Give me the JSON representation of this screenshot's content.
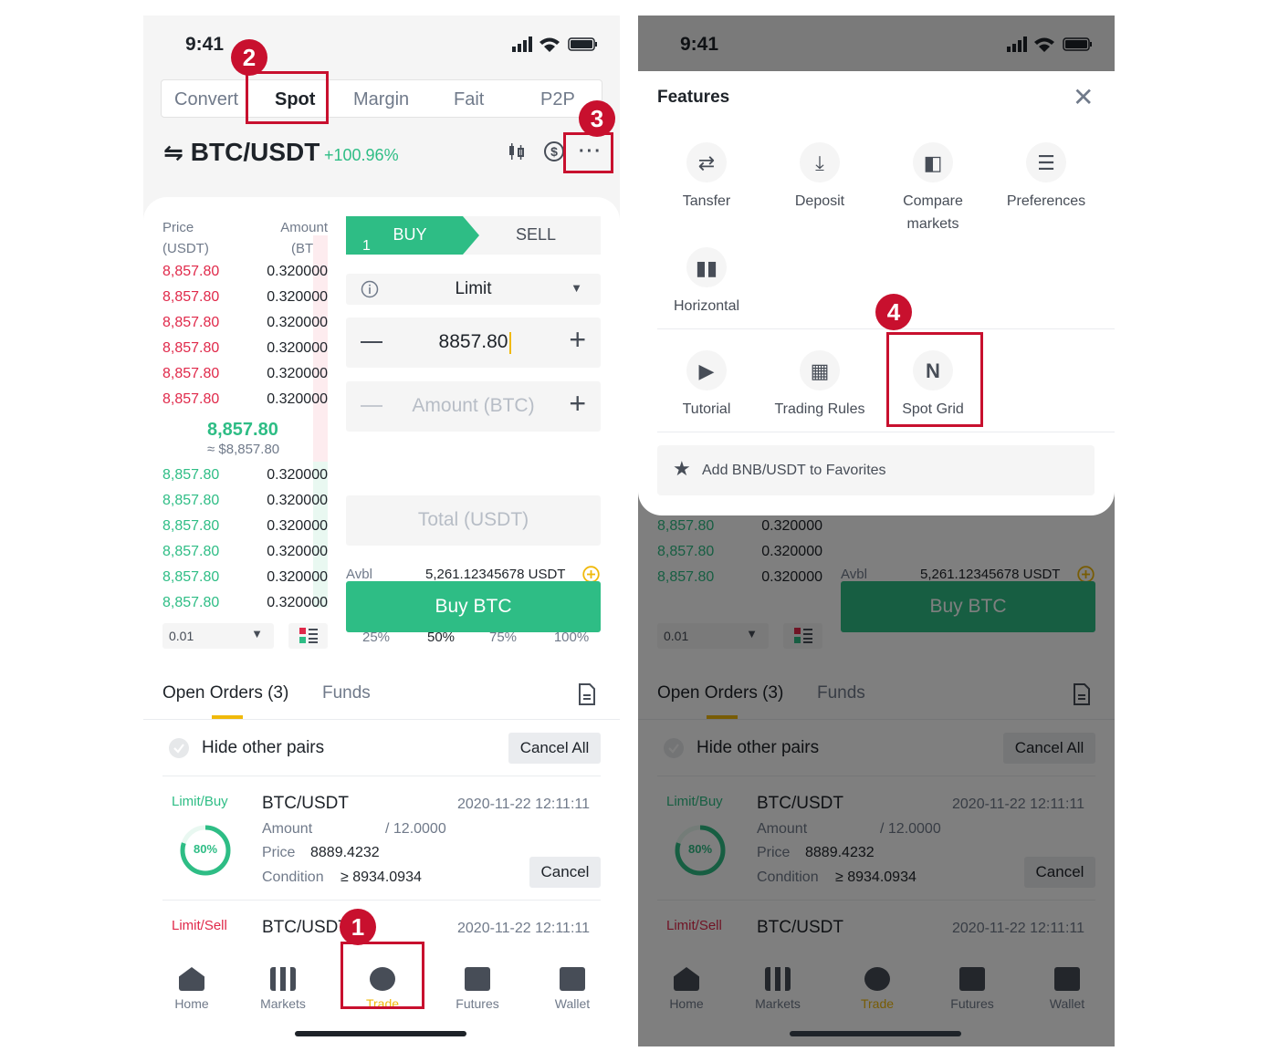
{
  "status": {
    "time": "9:41"
  },
  "tabs": [
    "Convert",
    "Spot",
    "Margin",
    "Fait",
    "P2P"
  ],
  "pair": {
    "symbol": "BTC/USDT",
    "change": "+100.96%"
  },
  "orderbook": {
    "price_header": [
      "Price",
      "(USDT)"
    ],
    "amount_header": [
      "Amount",
      "(BTC)"
    ],
    "asks": [
      [
        "8,857.80",
        "0.320000"
      ],
      [
        "8,857.80",
        "0.320000"
      ],
      [
        "8,857.80",
        "0.320000"
      ],
      [
        "8,857.80",
        "0.320000"
      ],
      [
        "8,857.80",
        "0.320000"
      ],
      [
        "8,857.80",
        "0.320000"
      ]
    ],
    "mid_price": "8,857.80",
    "mid_sub": "≈ $8,857.80",
    "bids": [
      [
        "8,857.80",
        "0.320000"
      ],
      [
        "8,857.80",
        "0.320000"
      ],
      [
        "8,857.80",
        "0.320000"
      ],
      [
        "8,857.80",
        "0.320000"
      ],
      [
        "8,857.80",
        "0.320000"
      ],
      [
        "8,857.80",
        "0.320000"
      ]
    ],
    "precision": "0.01"
  },
  "trade": {
    "buy": "BUY",
    "sell": "SELL",
    "buy_mark": "1",
    "order_type": "Limit",
    "price_value": "8857.80",
    "amount_placeholder": "Amount (BTC)",
    "percents": [
      "25%",
      "50%",
      "75%",
      "100%"
    ],
    "total_placeholder": "Total (USDT)",
    "avbl_label": "Avbl",
    "avbl_value": "5,261.12345678 USDT",
    "buy_button": "Buy BTC"
  },
  "orders": {
    "tab_open": "Open Orders (3)",
    "tab_funds": "Funds",
    "hide_pairs": "Hide other pairs",
    "cancel_all": "Cancel All",
    "items": [
      {
        "side": "Limit/Buy",
        "pair": "BTC/USDT",
        "datetime": "2020-11-22  12:11:11",
        "progress": "80%",
        "amount_label": "Amount",
        "amount_value": "/ 12.0000",
        "price_label": "Price",
        "price_value": "8889.4232",
        "condition_label": "Condition",
        "condition_value": "≥ 8934.0934",
        "cancel": "Cancel"
      },
      {
        "side": "Limit/Sell",
        "pair": "BTC/USDT",
        "datetime": "2020-11-22  12:11:11"
      }
    ]
  },
  "nav": [
    "Home",
    "Markets",
    "Trade",
    "Futures",
    "Wallet"
  ],
  "features": {
    "title": "Features",
    "items": [
      "Tansfer",
      "Deposit",
      "Compare markets",
      "Preferences",
      "Horizontal"
    ],
    "items2": [
      "Tutorial",
      "Trading Rules",
      "Spot Grid"
    ],
    "favorites": "Add BNB/USDT to Favorites"
  },
  "steps": [
    "1",
    "2",
    "3",
    "4"
  ],
  "colors": {
    "green": "#2ebd85",
    "red": "#e0294a",
    "annotation": "#c8102e",
    "yellow": "#f0b90b"
  }
}
